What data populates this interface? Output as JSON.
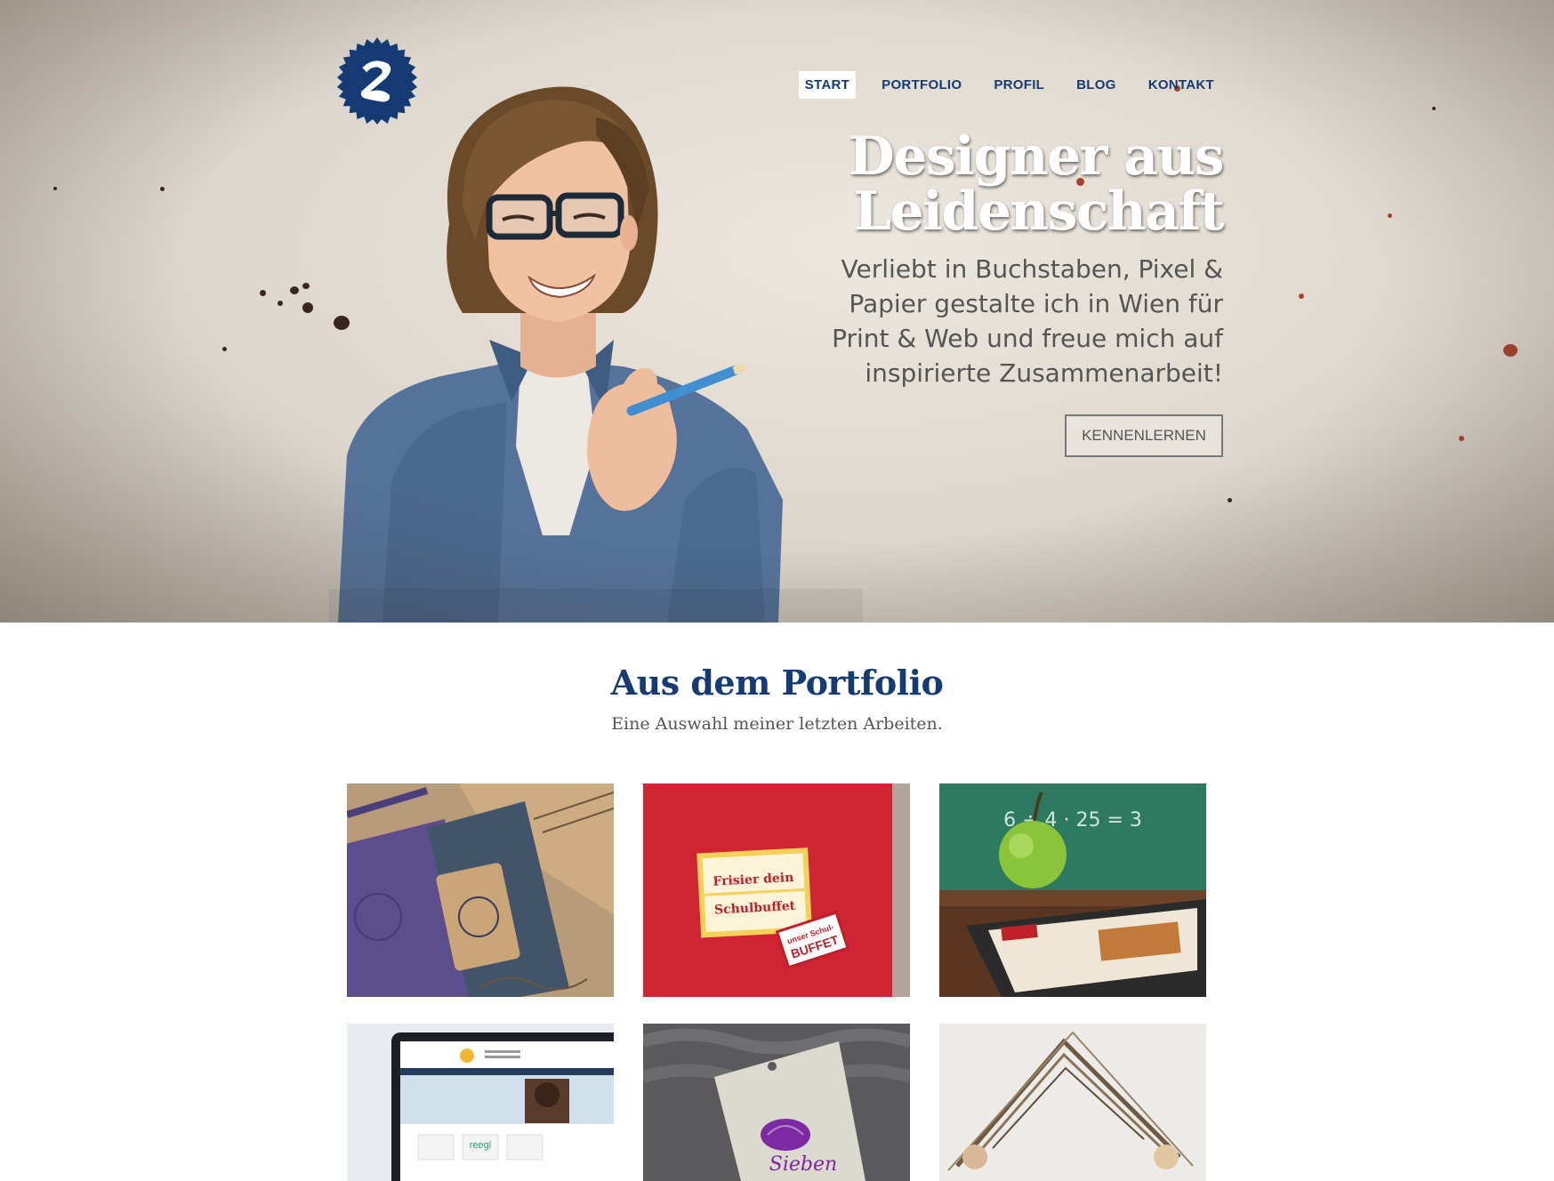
{
  "nav": {
    "items": [
      {
        "label": "START",
        "active": true
      },
      {
        "label": "PORTFOLIO",
        "active": false
      },
      {
        "label": "PROFIL",
        "active": false
      },
      {
        "label": "BLOG",
        "active": false
      },
      {
        "label": "KONTAKT",
        "active": false
      }
    ]
  },
  "hero": {
    "headline_line1": "Designer aus",
    "headline_line2": "Leidenschaft",
    "intro_line1": "Verliebt in Buchstaben, Pixel &",
    "intro_line2": "Papier gestalte ich in Wien für",
    "intro_line3": "Print & Web und freue mich auf",
    "intro_line4": "inspirierte Zusammenarbeit!",
    "cta_label": "KENNENLERNEN"
  },
  "portfolio": {
    "title": "Aus dem Portfolio",
    "subtitle": "Eine Auswahl meiner letzten Arbeiten.",
    "tiles": [
      {
        "image": "stationery-branding-photo"
      },
      {
        "image": "schulbuffet-red-cover-photo",
        "text1": "Frisier dein",
        "text2": "Schulbuffet",
        "badge1": "unser Schul-",
        "badge2": "BUFFET"
      },
      {
        "image": "apple-tablet-chalkboard-photo",
        "chalk": "6 ÷ 4  ·  25 = 3"
      },
      {
        "image": "laptop-website-photo",
        "site_logo": "reegl"
      },
      {
        "image": "knitting-tag-photo",
        "tag_text": "Sieben"
      },
      {
        "image": "branches-roof-photo"
      }
    ]
  },
  "colors": {
    "brand_navy": "#163a74",
    "text_gray": "#555555",
    "white": "#ffffff"
  }
}
